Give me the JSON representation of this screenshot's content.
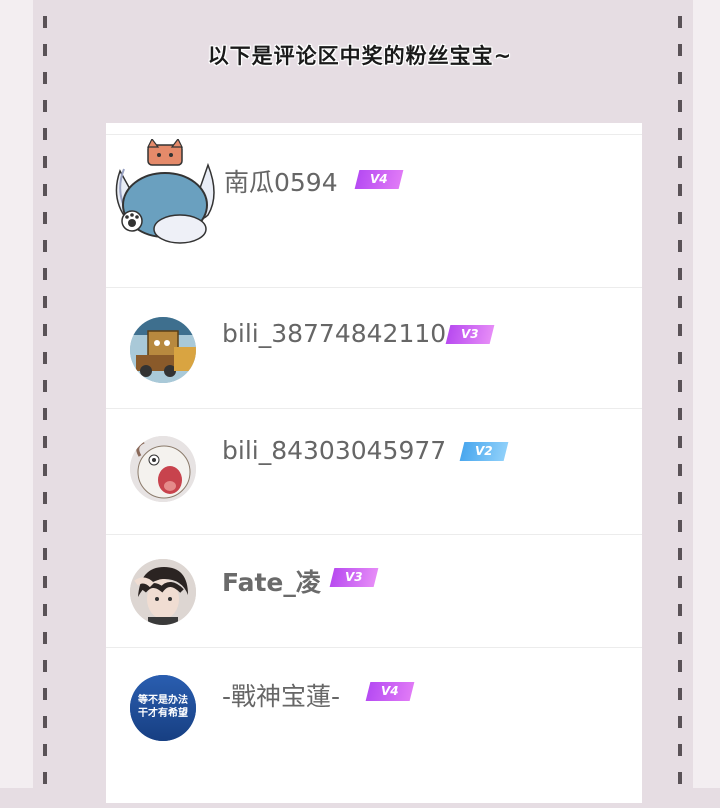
{
  "header": {
    "title": "以下是评论区中奖的粉丝宝宝~"
  },
  "winners": [
    {
      "name": "南瓜0594",
      "level": "V4",
      "avatar_icon": "cat-slime-avatar-icon"
    },
    {
      "name": "bili_38774842110",
      "level": "V3",
      "avatar_icon": "cartoon-sponge-avatar-icon"
    },
    {
      "name": "bili_84303045977",
      "level": "V2",
      "avatar_icon": "screaming-sheep-avatar-icon"
    },
    {
      "name": "Fate_凌",
      "level": "V3",
      "avatar_icon": "anime-boy-avatar-icon"
    },
    {
      "name": "-戰神宝蓮-",
      "level": "V4",
      "avatar_icon": "sign-avatar-icon",
      "avatar_text": [
        "等不是办法",
        "干才有希望"
      ]
    }
  ],
  "colors": {
    "background": "#e6dde3",
    "dash": "#5a5257",
    "v4_badge": "#b64bf3",
    "v2_badge": "#4aa7ee"
  }
}
